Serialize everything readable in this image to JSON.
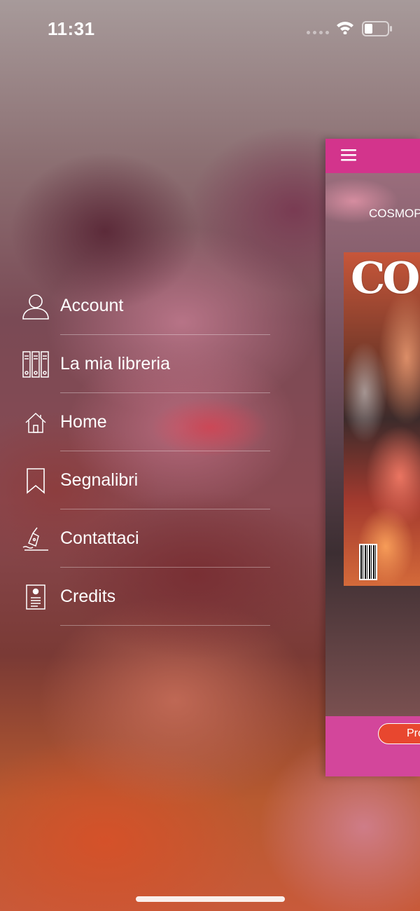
{
  "status_bar": {
    "time": "11:31",
    "icons": [
      "signal-dots",
      "wifi-icon",
      "battery-icon"
    ]
  },
  "menu": {
    "items": [
      {
        "label": "Account",
        "icon": "user-icon"
      },
      {
        "label": "La mia libreria",
        "icon": "library-binders-icon"
      },
      {
        "label": "Home",
        "icon": "home-icon"
      },
      {
        "label": "Segnalibri",
        "icon": "bookmark-icon"
      },
      {
        "label": "Contattaci",
        "icon": "pen-sign-icon"
      },
      {
        "label": "Credits",
        "icon": "credits-document-icon"
      }
    ]
  },
  "preview": {
    "header_icon": "menu-burger-icon",
    "magazine_name": "COSMOP",
    "cover_title": "COSM",
    "button_label": "Pro"
  },
  "colors": {
    "header_pink": "#d3348c",
    "footer_pink": "#d3469b",
    "button_orange": "#e8472f",
    "text_white": "#ffffff"
  }
}
